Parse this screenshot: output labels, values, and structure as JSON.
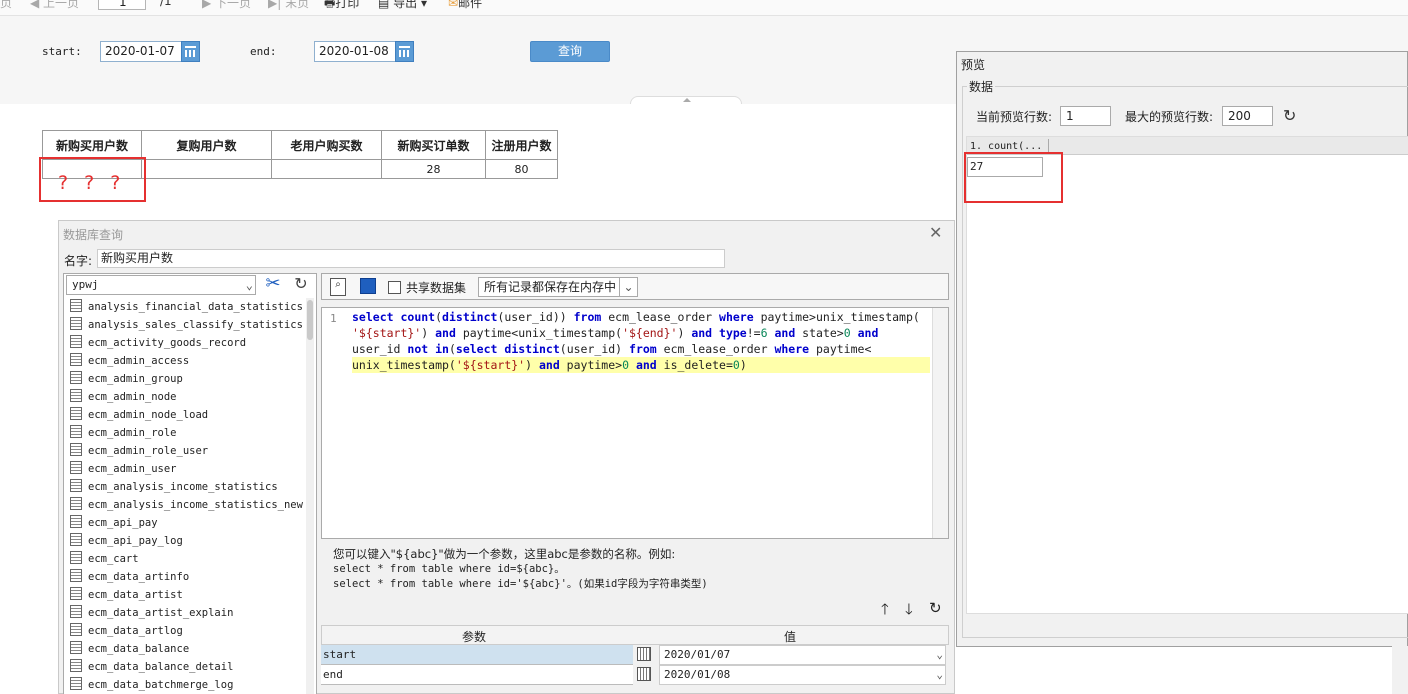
{
  "toolbar": {
    "first": "页",
    "prev": "上一页",
    "page_current": "1",
    "page_sep": "/1",
    "next": "下一页",
    "last": "末页",
    "print": "打印",
    "export": "导出",
    "email": "邮件"
  },
  "params": {
    "start_label": "start:",
    "start_value": "2020-01-07",
    "end_label": "end:",
    "end_value": "2020-01-08",
    "query_button": "查询"
  },
  "report": {
    "headers": [
      "新购买用户数",
      "复购用户数",
      "老用户购买数",
      "新购买订单数",
      "注册用户数"
    ],
    "row": [
      "",
      "",
      "",
      "28",
      "80"
    ],
    "annotation": "? ? ?"
  },
  "db_dialog": {
    "title": "数据库查询",
    "name_label": "名字:",
    "name_value": "新购买用户数",
    "connection": "ypwj",
    "tables": [
      "analysis_financial_data_statistics",
      "analysis_sales_classify_statistics",
      "ecm_activity_goods_record",
      "ecm_admin_access",
      "ecm_admin_group",
      "ecm_admin_node",
      "ecm_admin_node_load",
      "ecm_admin_role",
      "ecm_admin_role_user",
      "ecm_admin_user",
      "ecm_analysis_income_statistics",
      "ecm_analysis_income_statistics_new",
      "ecm_api_pay",
      "ecm_api_pay_log",
      "ecm_cart",
      "ecm_data_artinfo",
      "ecm_data_artist",
      "ecm_data_artist_explain",
      "ecm_data_artlog",
      "ecm_data_balance",
      "ecm_data_balance_detail",
      "ecm_data_batchmerge_log"
    ],
    "share_label": "共享数据集",
    "memory_option": "所有记录都保存在内存中",
    "line_number": "1",
    "help_line1": "您可以键入\"${abc}\"做为一个参数，这里abc是参数的名称。例如:",
    "help_line2": "select * from table where id=${abc}。",
    "help_line3": "select * from table where id='${abc}'。(如果id字段为字符串类型)",
    "param_header": "参数",
    "value_header": "值",
    "param_rows": [
      {
        "name": "start",
        "value": "2020/01/07"
      },
      {
        "name": "end",
        "value": "2020/01/08"
      }
    ]
  },
  "preview": {
    "title": "预览",
    "group_label": "数据",
    "current_rows_label": "当前预览行数:",
    "current_rows_value": "1",
    "max_rows_label": "最大的预览行数:",
    "max_rows_value": "200",
    "column_header": "1. count(...",
    "cell_value": "27"
  },
  "colors": {
    "accent": "#5b9bd5",
    "annotation_red": "#e53030",
    "highlight_line": "#ffffaa"
  }
}
